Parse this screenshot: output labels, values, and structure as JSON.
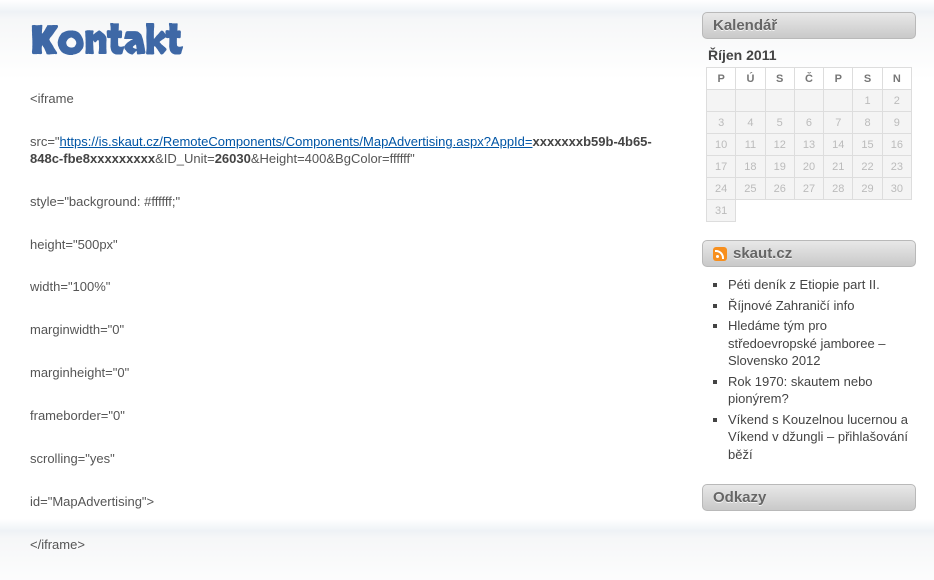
{
  "page": {
    "title": "Kontakt"
  },
  "content": {
    "l1": "<iframe",
    "l2_a": "src=\"",
    "l2_link": "https://is.skaut.cz/RemoteComponents/Components/MapAdvertising.aspx?AppId=",
    "l2_b1": "xxxxxxxb59b-4b65-848c-fbe8xxxxxxxxx",
    "l2_b2": "&ID_Unit=",
    "l2_b3": "26030",
    "l2_b4": "&Height=400&BgColor=ffffff\"",
    "l3": "style=\"background: #ffffff;\"",
    "l4": "height=\"500px\"",
    "l5": "width=\"100%\"",
    "l6": "marginwidth=\"0\"",
    "l7": "marginheight=\"0\"",
    "l8": "frameborder=\"0\"",
    "l9": "scrolling=\"yes\"",
    "l10": "id=\"MapAdvertising\">",
    "l11": "</iframe>"
  },
  "calendar": {
    "title": "Kalendář",
    "caption": "Říjen 2011",
    "dow": [
      "P",
      "Ú",
      "S",
      "Č",
      "P",
      "S",
      "N"
    ],
    "weeks": [
      [
        "",
        "",
        "",
        "",
        "",
        "1",
        "2"
      ],
      [
        "3",
        "4",
        "5",
        "6",
        "7",
        "8",
        "9"
      ],
      [
        "10",
        "11",
        "12",
        "13",
        "14",
        "15",
        "16"
      ],
      [
        "17",
        "18",
        "19",
        "20",
        "21",
        "22",
        "23"
      ],
      [
        "24",
        "25",
        "26",
        "27",
        "28",
        "29",
        "30"
      ],
      [
        "31",
        "",
        "",
        "",
        "",
        "",
        ""
      ]
    ]
  },
  "feed": {
    "title": "skaut.cz",
    "items": [
      "Péti deník z Etiopie part II.",
      "Říjnové Zahraničí info",
      "Hledáme tým pro středoevropské jamboree – Slovensko 2012",
      "Rok 1970: skautem nebo pionýrem?",
      "Víkend s Kouzelnou lucernou a Víkend v džungli – přihlašování běží"
    ]
  },
  "links": {
    "title": "Odkazy"
  }
}
